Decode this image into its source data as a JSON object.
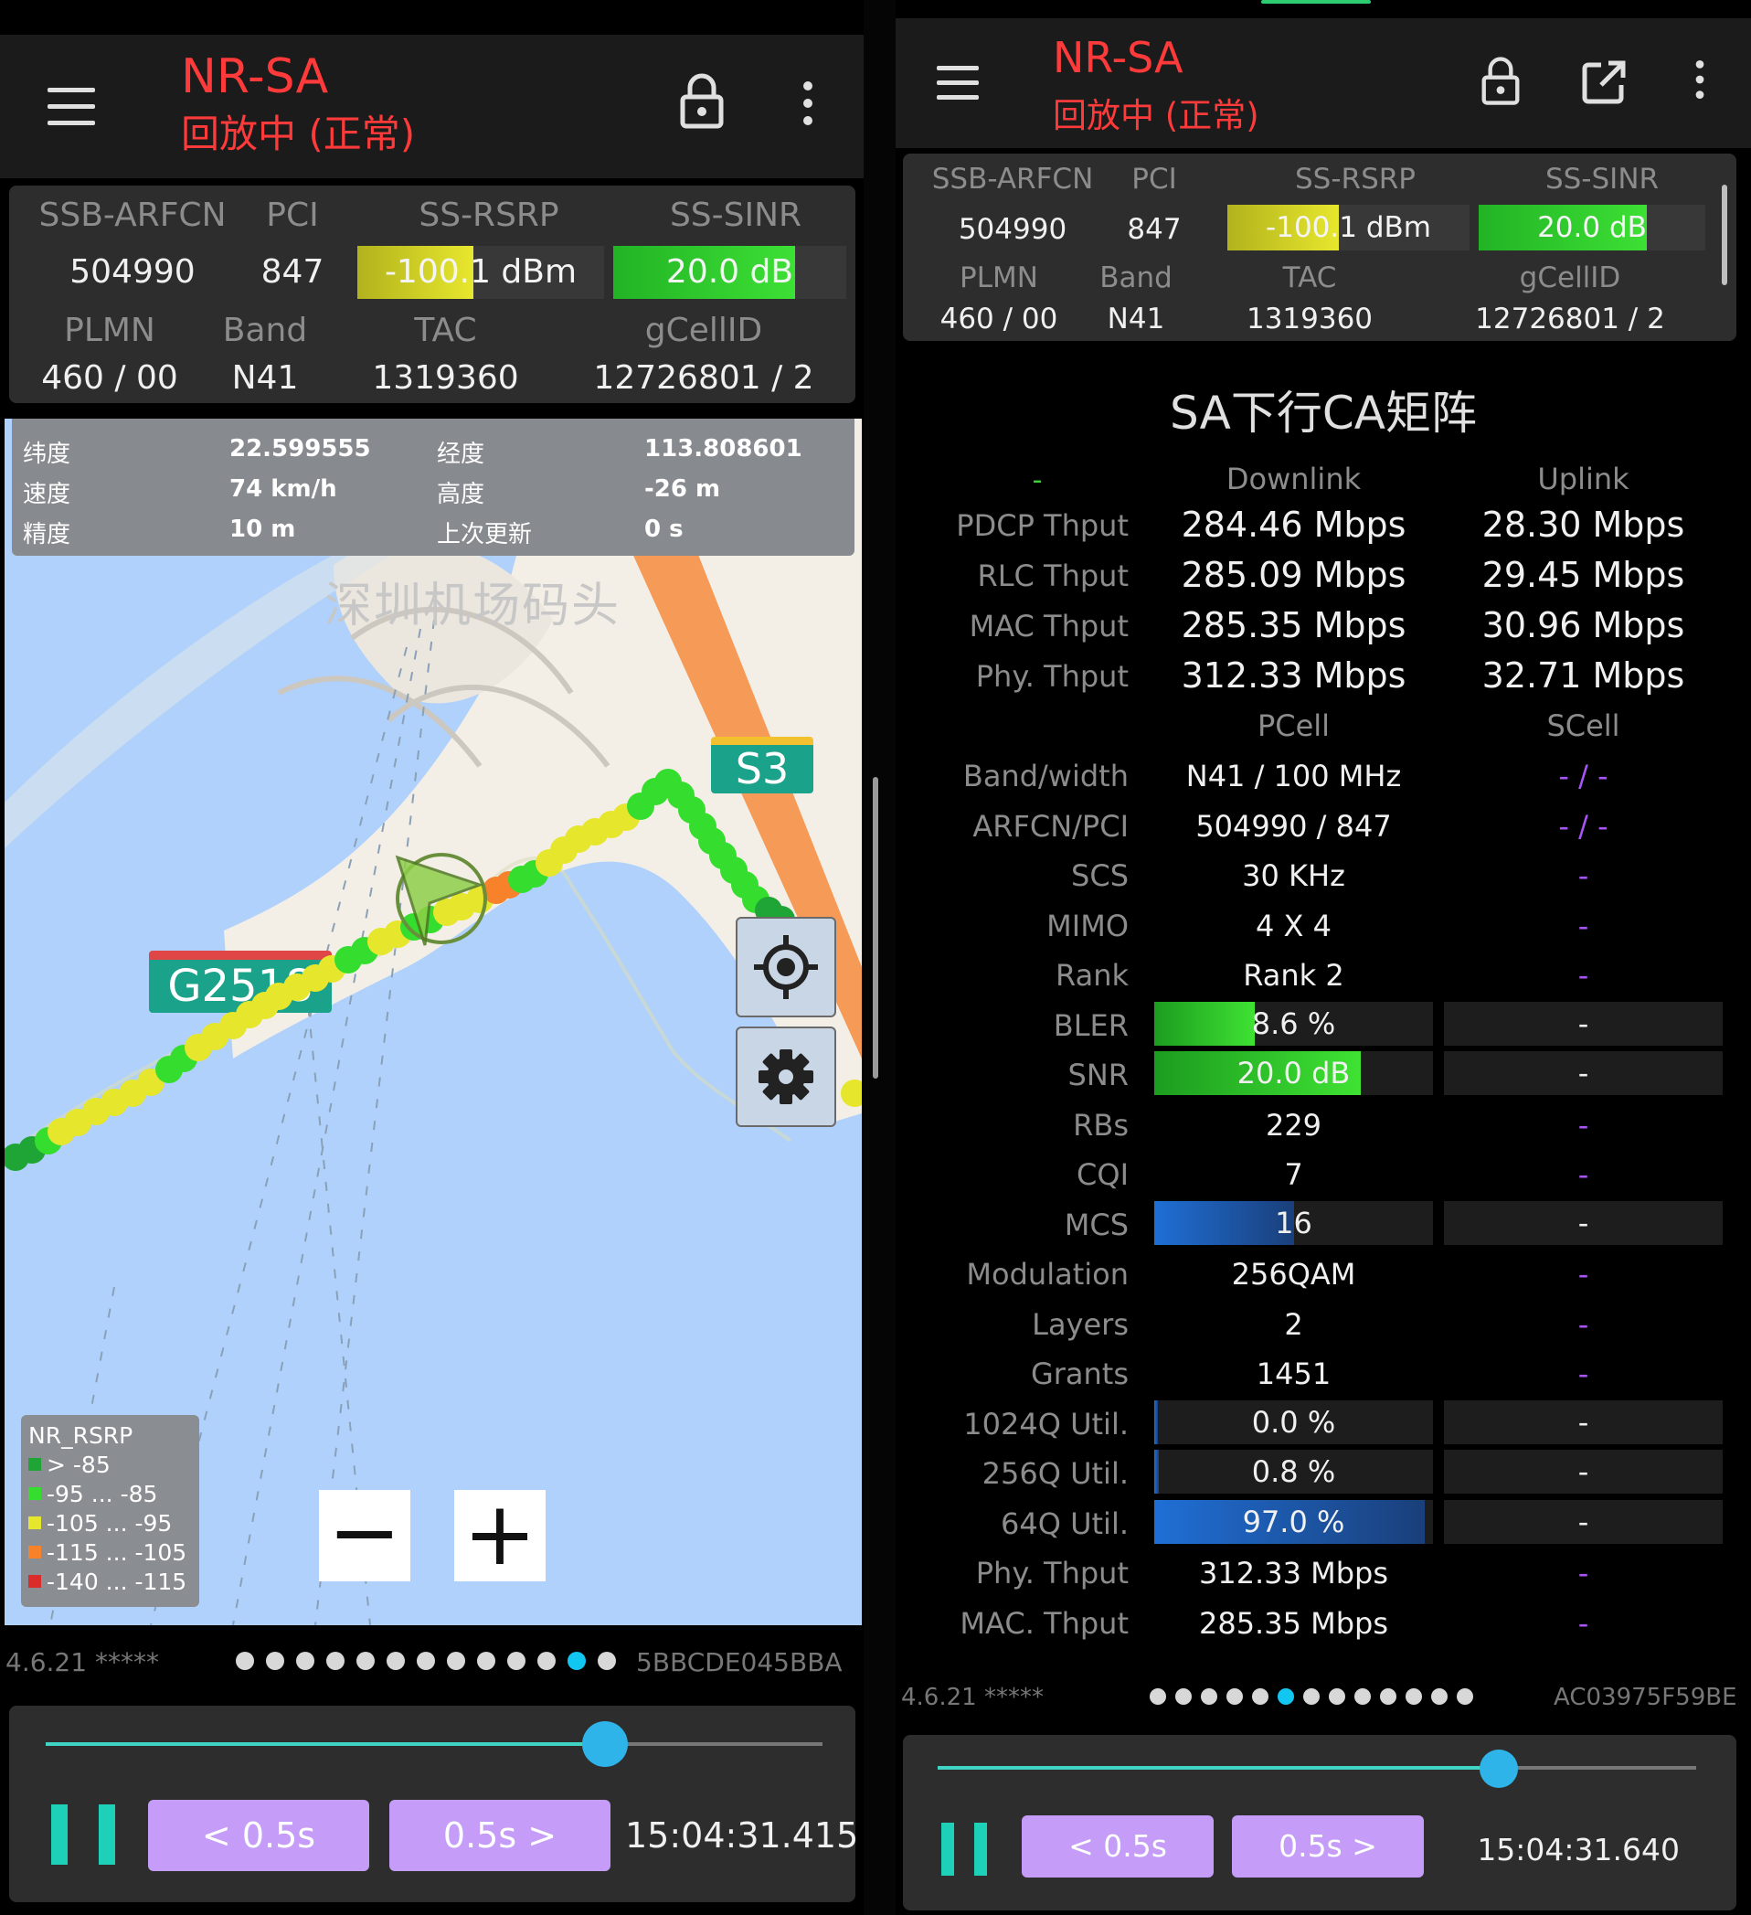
{
  "left": {
    "title": "NR-SA",
    "subtitle": "回放中 (正常)",
    "labels_row1": [
      "SSB-ARFCN",
      "PCI",
      "SS-RSRP",
      "SS-SINR"
    ],
    "ssb_arfcn": "504990",
    "pci": "847",
    "rsrp": "-100.1 dBm",
    "sinr": "20.0 dB",
    "labels_row2": [
      "PLMN",
      "Band",
      "TAC",
      "gCellID"
    ],
    "plmn": "460 / 00",
    "band": "N41",
    "tac": "1319360",
    "gcellid": "12726801 / 2",
    "gps": {
      "lat_label": "纬度",
      "lat": "22.599555",
      "lon_label": "经度",
      "lon": "113.808601",
      "speed_label": "速度",
      "speed": "74 km/h",
      "alt_label": "高度",
      "alt": "-26 m",
      "acc_label": "精度",
      "acc": "10 m",
      "upd_label": "上次更新",
      "upd": "0 s"
    },
    "map": {
      "place": "深圳机场码头",
      "road1": "S3",
      "road2": "G2518"
    },
    "legend": {
      "title": "NR_RSRP",
      "items": [
        {
          "label": "> -85",
          "color": "#1fa535"
        },
        {
          "label": "-95 ... -85",
          "color": "#35de2e"
        },
        {
          "label": "-105 ... -95",
          "color": "#e6e62c"
        },
        {
          "label": "-115 ... -105",
          "color": "#f7822a"
        },
        {
          "label": "-140 ... -115",
          "color": "#dc2b2b"
        }
      ]
    },
    "zoom_out": "−",
    "zoom_in": "+",
    "version": "4.6.21 *****",
    "device_id": "5BBCDE045BBA",
    "page_dots": 13,
    "active_dot": 11,
    "back_label": "< 0.5s",
    "fwd_label": "0.5s >",
    "time": "15:04:31.415",
    "progress": 0.72,
    "rsrp_fill": 0.47,
    "sinr_fill": 0.78
  },
  "right": {
    "title": "NR-SA",
    "subtitle": "回放中 (正常)",
    "labels_row1": [
      "SSB-ARFCN",
      "PCI",
      "SS-RSRP",
      "SS-SINR"
    ],
    "ssb_arfcn": "504990",
    "pci": "847",
    "rsrp": "-100.1 dBm",
    "sinr": "20.0 dB",
    "labels_row2": [
      "PLMN",
      "Band",
      "TAC",
      "gCellID"
    ],
    "plmn": "460 / 00",
    "band": "N41",
    "tac": "1319360",
    "gcellid": "12726801 / 2",
    "matrix_title": "SA下行CA矩阵",
    "marker": "-",
    "col_downlink": "Downlink",
    "col_uplink": "Uplink",
    "thput": [
      {
        "label": "PDCP Thput",
        "down": "284.46 Mbps",
        "up": "28.30 Mbps"
      },
      {
        "label": "RLC Thput",
        "down": "285.09 Mbps",
        "up": "29.45 Mbps"
      },
      {
        "label": "MAC Thput",
        "down": "285.35 Mbps",
        "up": "30.96 Mbps"
      },
      {
        "label": "Phy. Thput",
        "down": "312.33 Mbps",
        "up": "32.71 Mbps"
      }
    ],
    "col_pcell": "PCell",
    "col_scell": "SCell",
    "cells": [
      {
        "label": "Band/width",
        "p": "N41 / 100 MHz",
        "s": "- / -"
      },
      {
        "label": "ARFCN/PCI",
        "p": "504990 / 847",
        "s": "- / -"
      },
      {
        "label": "SCS",
        "p": "30 KHz",
        "s": "-"
      },
      {
        "label": "MIMO",
        "p": "4 X 4",
        "s": "-"
      },
      {
        "label": "Rank",
        "p": "Rank 2",
        "s": "-"
      },
      {
        "label": "BLER",
        "p": "8.6 %",
        "s": "-",
        "fill": 0.36,
        "color": "green"
      },
      {
        "label": "SNR",
        "p": "20.0 dB",
        "s": "-",
        "fill": 0.74,
        "color": "green"
      },
      {
        "label": "RBs",
        "p": "229",
        "s": "-"
      },
      {
        "label": "CQI",
        "p": "7",
        "s": "-"
      },
      {
        "label": "MCS",
        "p": "16",
        "s": "-",
        "fill": 0.5,
        "color": "blue"
      },
      {
        "label": "Modulation",
        "p": "256QAM",
        "s": "-"
      },
      {
        "label": "Layers",
        "p": "2",
        "s": "-"
      },
      {
        "label": "Grants",
        "p": "1451",
        "s": "-"
      },
      {
        "label": "1024Q Util.",
        "p": "0.0 %",
        "s": "-",
        "fill": 0.0,
        "color": "blue"
      },
      {
        "label": "256Q Util.",
        "p": "0.8 %",
        "s": "-",
        "fill": 0.008,
        "color": "blue"
      },
      {
        "label": "64Q Util.",
        "p": "97.0 %",
        "s": "-",
        "fill": 0.97,
        "color": "blue"
      },
      {
        "label": "Phy. Thput",
        "p": "312.33 Mbps",
        "s": "-"
      },
      {
        "label": "MAC. Thput",
        "p": "285.35 Mbps",
        "s": "-"
      }
    ],
    "version": "4.6.21 *****",
    "device_id": "AC03975F59BE",
    "page_dots": 13,
    "active_dot": 5,
    "back_label": "< 0.5s",
    "fwd_label": "0.5s >",
    "time": "15:04:31.640",
    "progress": 0.74,
    "rsrp_fill": 0.46,
    "sinr_fill": 0.74
  }
}
